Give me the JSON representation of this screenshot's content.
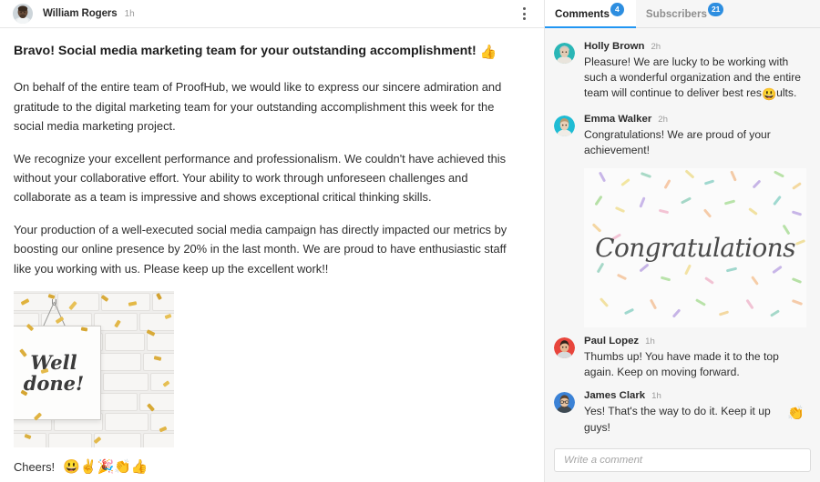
{
  "post": {
    "author": "William Rogers",
    "timestamp": "1h",
    "menu_icon": "kebab-menu-icon",
    "title": "Bravo! Social media marketing team for your outstanding accomplishment!",
    "title_emoji": "👍",
    "paragraphs": [
      "On behalf of the entire team of ProofHub, we would like to express our sincere admiration and gratitude to the digital marketing team for your outstanding accomplishment this week for the social media marketing project.",
      "We recognize your excellent performance and professionalism. We couldn't have achieved this without your collaborative effort. Your ability to work through unforeseen challenges and collaborate as a team is impressive and shows exceptional critical thinking skills.",
      "Your production of a well-executed social media campaign has directly impacted our metrics by boosting our online presence by 20% in the last month. We are proud to have enthusiastic staff like you working with us. Please keep up the excellent work!!"
    ],
    "attachment": {
      "alt": "Well done sign hanging on white brick wall with gold confetti",
      "sign_line1": "Well",
      "sign_line2": "done!"
    },
    "signoff": "Cheers!",
    "signoff_emojis": "😃✌️🎉👏👍"
  },
  "tabs": [
    {
      "label": "Comments",
      "badge": "4",
      "active": true
    },
    {
      "label": "Subscribers",
      "badge": "21",
      "active": false
    }
  ],
  "comments": [
    {
      "author": "Holly Brown",
      "timestamp": "2h",
      "text": "Pleasure! We are lucky to be working with such a wonderful organization and the entire team will continue to deliver best res",
      "text_tail": "ults.",
      "inline_emoji": "😃",
      "avatar_color": "#2ab6b6"
    },
    {
      "author": "Emma Walker",
      "timestamp": "2h",
      "text": "Congratulations! We are proud of your achievement!",
      "avatar_color": "#1fbcd4",
      "attachment": {
        "caption": "Congratulations",
        "alt": "Congratulations lettering with pastel confetti sprinkles"
      }
    },
    {
      "author": "Paul Lopez",
      "timestamp": "1h",
      "text": "Thumbs up! You have made it to the top again. Keep on moving forward.",
      "avatar_color": "#e8453c"
    },
    {
      "author": "James Clark",
      "timestamp": "1h",
      "text": "Yes! That's the way to do it. Keep it up guys!",
      "trailing_emoji": "👏",
      "avatar_color": "#3b82d6"
    }
  ],
  "composer": {
    "placeholder": "Write a comment",
    "value": ""
  },
  "colors": {
    "accent": "#2196f3",
    "badge": "#2d8ee0",
    "panel_bg": "#f6f6f6",
    "border": "#e6e6e6",
    "text": "#2e2e2e"
  }
}
